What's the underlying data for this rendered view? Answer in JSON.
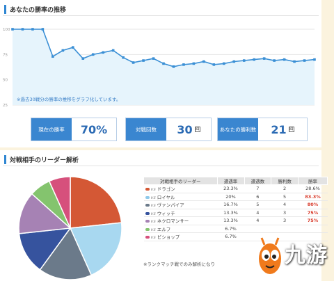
{
  "trend_section": {
    "title": "あなたの勝率の推移",
    "note": "※過去30戦分の勝率の推移をグラフ化しています。",
    "accent_color": "#2f86d2",
    "line_color": "#3a8fd5",
    "fill_color": "#e6f4fc"
  },
  "chart_data": [
    {
      "type": "line",
      "title": "",
      "xlabel": "",
      "ylabel": "",
      "yticks": [
        "100",
        "75",
        "50",
        "25"
      ],
      "ylim": [
        25,
        100
      ],
      "grid": true,
      "legend": "none",
      "values": [
        100,
        100,
        100,
        100,
        73,
        79,
        82,
        71,
        75,
        77,
        79,
        72,
        67,
        69,
        71,
        66,
        63,
        65,
        66,
        68,
        65,
        66,
        68,
        69,
        70,
        71,
        69,
        70,
        68,
        69,
        70
      ]
    },
    {
      "type": "pie",
      "title": "",
      "legend": "none",
      "slices": [
        {
          "name": "ドラゴン",
          "value": 23.3,
          "color": "#d45835"
        },
        {
          "name": "ロイヤル",
          "value": 20,
          "color": "#a8d8f0"
        },
        {
          "name": "ヴァンパイア",
          "value": 16.7,
          "color": "#6b7a8a"
        },
        {
          "name": "ウィッチ",
          "value": 13.3,
          "color": "#36539e"
        },
        {
          "name": "ネクロマンサー",
          "value": 13.3,
          "color": "#a682b4"
        },
        {
          "name": "エルフ",
          "value": 6.7,
          "color": "#84c46e"
        },
        {
          "name": "ビショップ",
          "value": 6.7,
          "color": "#d6507c"
        }
      ]
    }
  ],
  "stats": [
    {
      "label": "現在の勝率",
      "value": "70%",
      "unit": ""
    },
    {
      "label": "対戦回数",
      "value": "30",
      "unit": "回"
    },
    {
      "label": "あなたの勝利数",
      "value": "21",
      "unit": "回"
    }
  ],
  "leader_section": {
    "title": "対戦相手のリーダー解析",
    "note": "※ランクマッチ戦でのみ解析になり"
  },
  "leader_table": {
    "headers": [
      "対戦相手のリーダー",
      "遭遇率",
      "遭遇数",
      "勝利数",
      "勝率"
    ],
    "vs": "vs",
    "rows": [
      {
        "leader": "ドラゴン",
        "rate": "23.3%",
        "count": "7",
        "wins": "2",
        "winrate": "28.6%",
        "hi": false,
        "color": "#d45835"
      },
      {
        "leader": "ロイヤル",
        "rate": "20%",
        "count": "6",
        "wins": "5",
        "winrate": "83.3%",
        "hi": true,
        "color": "#8fc9ea"
      },
      {
        "leader": "ヴァンパイア",
        "rate": "16.7%",
        "count": "5",
        "wins": "4",
        "winrate": "80%",
        "hi": true,
        "color": "#6b7a8a"
      },
      {
        "leader": "ウィッチ",
        "rate": "13.3%",
        "count": "4",
        "wins": "3",
        "winrate": "75%",
        "hi": true,
        "color": "#36539e"
      },
      {
        "leader": "ネクロマンサー",
        "rate": "13.3%",
        "count": "4",
        "wins": "3",
        "winrate": "75%",
        "hi": true,
        "color": "#a682b4"
      },
      {
        "leader": "エルフ",
        "rate": "6.7%",
        "count": "",
        "wins": "",
        "winrate": "",
        "hi": false,
        "color": "#84c46e"
      },
      {
        "leader": "ビショップ",
        "rate": "6.7%",
        "count": "",
        "wins": "",
        "winrate": "",
        "hi": false,
        "color": "#d6507c"
      }
    ]
  },
  "watermark": {
    "text": "九游",
    "color": "#f07a1c"
  }
}
